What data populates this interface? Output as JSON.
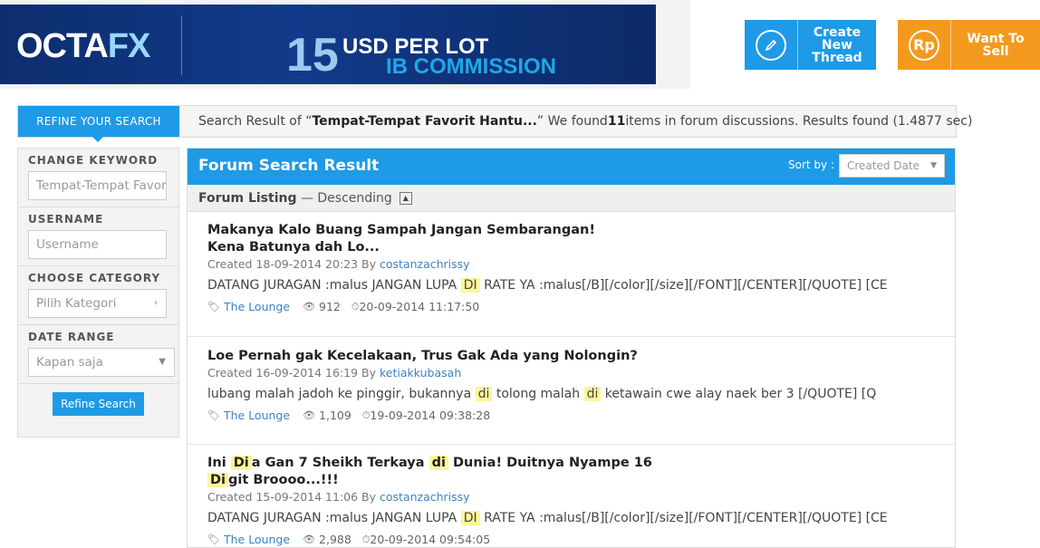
{
  "banner": {
    "logo_main": "OCTA",
    "logo_fx": "FX",
    "amount": "15",
    "line1": "USD PER LOT",
    "line2": "IB COMMISSION"
  },
  "header": {
    "create_thread": "Create New Thread",
    "create_icon": "pencil-icon",
    "want_to_sell": "Want To Sell",
    "sell_icon_text": "Rp",
    "create_color": "#1e9ae6",
    "sell_color": "#f39a1e"
  },
  "result_bar": {
    "tab_label": "REFINE YOUR SEARCH",
    "prefix": "Search Result of “",
    "query": "Tempat-Tempat Favorit Hantu...",
    "middle": "” We found ",
    "count": "11",
    "suffix": " items in forum discussions. Results found (1.4877 sec)"
  },
  "sidebar": {
    "keyword_title": "CHANGE KEYWORD",
    "keyword_value": "Tempat-Tempat Favorit Hantu",
    "username_title": "USERNAME",
    "username_placeholder": "Username",
    "category_title": "CHOOSE CATEGORY",
    "category_value": "Pilih Kategori",
    "date_title": "DATE RANGE",
    "date_value": "Kapan saja",
    "refine_button": "Refine Search"
  },
  "main": {
    "title": "Forum Search Result",
    "sort_label": "Sort by :",
    "sort_value": "Created Date",
    "listing_label": "Forum Listing",
    "listing_order": "— Descending"
  },
  "threads": [
    {
      "title": "Makanya Kalo Buang Sampah Jangan Sembarangan! Kena Batunya dah Lo...",
      "created_prefix": "Created 18-09-2014 20:23 By ",
      "author": "costanzachrissy",
      "snip_a": "DATANG JURAGAN :malus JANGAN LUPA ",
      "snip_hl": "DI",
      "snip_b": " RATE YA :malus[/B][/color][/size][/FONT][/CENTER][/QUOTE] [CE",
      "category": "The Lounge",
      "views": "912",
      "last": "20-09-2014 11:17:50"
    },
    {
      "title": "Loe Pernah gak Kecelakaan, Trus Gak Ada yang Nolongin?",
      "created_prefix": "Created 16-09-2014 16:19 By ",
      "author": "ketiakkubasah",
      "snip_a": "lubang malah jadoh ke pinggir, bukannya ",
      "snip_hl1": "di",
      "snip_b": " tolong malah ",
      "snip_hl2": "di",
      "snip_c": " ketawain cwe alay naek ber 3 [/QUOTE] [Q",
      "category": "The Lounge",
      "views": "1,109",
      "last": "19-09-2014 09:38:28"
    },
    {
      "title_a": "Ini ",
      "title_hl1": "Di",
      "title_b": "a Gan 7 Sheikh Terkaya ",
      "title_hl2": "di",
      "title_c": " Dunia! Duitnya Nyampe 16 ",
      "title_hl3": "Di",
      "title_d": "git Broooo...!!!",
      "created_prefix": "Created 15-09-2014 11:06 By ",
      "author": "costanzachrissy",
      "snip_a": "DATANG JURAGAN :malus JANGAN LUPA ",
      "snip_hl": "DI",
      "snip_b": " RATE YA :malus[/B][/color][/size][/FONT][/CENTER][/QUOTE] [CE",
      "category": "The Lounge",
      "views": "2,988",
      "last": "20-09-2014 09:54:05"
    }
  ]
}
